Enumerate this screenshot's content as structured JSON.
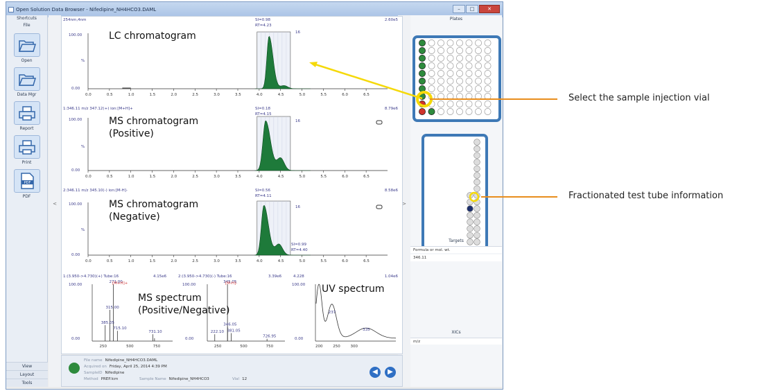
{
  "window": {
    "title": "Open Solution Data Browser - Nifedipine_NH4HCO3.DAML",
    "minimize": "–",
    "maximize": "□",
    "close": "✕"
  },
  "left_panel": {
    "shortcuts": "Shortcuts",
    "file": "File",
    "buttons": [
      "Open",
      "Data Mgr",
      "Report",
      "Print",
      "PDF"
    ],
    "bottom": [
      "View",
      "Layout",
      "Tools"
    ]
  },
  "splitters": {
    "left": "<",
    "right": ">"
  },
  "plots": {
    "lc": {
      "heading": "254nm,4nm",
      "scale": "2.60e5",
      "si": "SI=0.98",
      "rt": "RT=4.23",
      "frac": "16",
      "ytop": "100.00",
      "ymid": "%",
      "ybot": "0.00",
      "title": "LC chromatogram"
    },
    "ms_pos": {
      "heading": "1:346.11 m/z 347.12(+) ion:[M+H]+",
      "scale": "8.79e6",
      "si": "SI=0.18",
      "rt": "RT=4.15",
      "frac": "16",
      "ytop": "100.00",
      "ymid": "%",
      "ybot": "0.00",
      "title_l1": "MS chromatogram",
      "title_l2": "(Positive)"
    },
    "ms_neg": {
      "heading": "2:346.11 m/z 345.10(-) ion:[M-H]-",
      "scale": "8.58e6",
      "si": "SI=0.56",
      "rt": "RT=4.11",
      "si2": "SI=0.99",
      "rt2": "RT=4.40",
      "frac": "16",
      "ytop": "100.00",
      "ymid": "%",
      "ybot": "0.00",
      "title_l1": "MS chromatogram",
      "title_l2": "(Negative)"
    },
    "x_ticks": [
      "0.0",
      "0.5",
      "1.0",
      "1.5",
      "2.0",
      "2.5",
      "3.0",
      "3.5",
      "4.0",
      "4.5",
      "5.0",
      "5.5",
      "6.0",
      "6.5"
    ],
    "spectra": {
      "pos_heading": "1:(3.950->4.730)(+) Tube:16",
      "pos_scale": "4.15e6",
      "neg_heading": "2:(3.950->4.730)(-) Tube:16",
      "neg_scale": "3.39e6",
      "uv_heading": "4.228",
      "uv_scale": "1.04e6",
      "pos_ion": "[M+H]+",
      "neg_ion": "[M-H]-",
      "ytop": "100.00",
      "ybot": "0.00",
      "pos_peaks": [
        "315.00",
        "271.00",
        "385.05",
        "715.10",
        "731.10"
      ],
      "neg_peaks": [
        "345.05",
        "346.05",
        "222.10",
        "381.05",
        "726.95"
      ],
      "uv_peaks": [
        "237",
        "335"
      ],
      "ms_ticks": [
        "250",
        "500",
        "750"
      ],
      "uv_ticks": [
        "200",
        "250",
        "300"
      ],
      "ms_title_l1": "MS spectrum",
      "ms_title_l2": "(Positive/Negative)",
      "uv_title": "UV spectrum"
    }
  },
  "info": {
    "file_name_key": "File name",
    "file_name": "Nifedipine_NH4HCO3.DAML",
    "acquired_key": "Acquired on",
    "acquired": "Friday, April 25, 2014 4:39 PM",
    "sampleid_key": "SampleID",
    "sampleid": "Nifedipine",
    "method_key": "Method",
    "method": "PREP.lcm",
    "sample_name_key": "Sample Name",
    "sample_name": "Nifedipine_NH4HCO3",
    "vial_key": "Vial",
    "vial": "12"
  },
  "right_panel": {
    "plates": "Plates",
    "targets": "Targets",
    "formula_label": "Formula or mol. wt.",
    "formula_value": "346.11",
    "xics": "XICs",
    "mz_label": "m/z"
  },
  "callouts": {
    "select_vial": "Select the sample injection vial",
    "tube_info": "Fractionated test tube information"
  },
  "colors": {
    "peak_fill": "#1e7a3a",
    "frame_blue": "#3e79b6",
    "callout_orange": "#e88d1d",
    "highlight_yellow": "#f5d90a"
  }
}
